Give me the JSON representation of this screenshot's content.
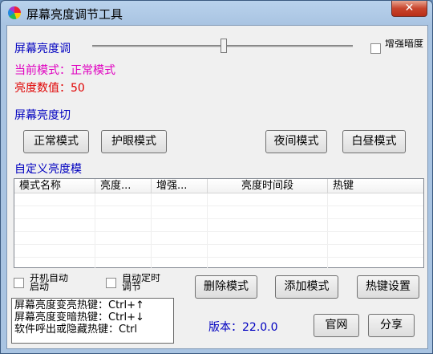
{
  "window": {
    "title": "屏幕亮度调节工具",
    "close_label": "✕"
  },
  "brightness": {
    "label": "屏幕亮度调",
    "slider_value": 50,
    "enhance_dark_label": "增强暗度",
    "enhance_dark_checked": false
  },
  "status": {
    "current_mode": "当前模式：正常模式",
    "brightness_value": "亮度数值：50"
  },
  "switch_section": {
    "label": "屏幕亮度切",
    "buttons": [
      "正常模式",
      "护眼模式",
      "夜间模式",
      "白昼模式"
    ]
  },
  "custom_section": {
    "label": "自定义亮度模",
    "columns": [
      "模式名称",
      "亮度...",
      "增强...",
      "亮度时间段",
      "热键"
    ],
    "rows": []
  },
  "options": {
    "autostart_label": "开机自动启动",
    "autostart_checked": false,
    "auto_schedule_label": "自动定时调节",
    "auto_schedule_checked": false
  },
  "actions": {
    "delete": "删除模式",
    "add": "添加模式",
    "hotkey_settings": "热键设置"
  },
  "hotkeys": {
    "lines": [
      "屏幕亮度变亮热键：Ctrl+↑",
      "屏幕亮度变暗热键：Ctrl+↓",
      "软件呼出或隐藏热键：Ctrl"
    ]
  },
  "footer": {
    "version": "版本：22.0.0",
    "website": "官网",
    "share": "分享"
  },
  "colors": {
    "label_blue": "#0000c0",
    "status_magenta": "#e000c0",
    "status_red": "#e00000",
    "close_red": "#c8452d"
  }
}
